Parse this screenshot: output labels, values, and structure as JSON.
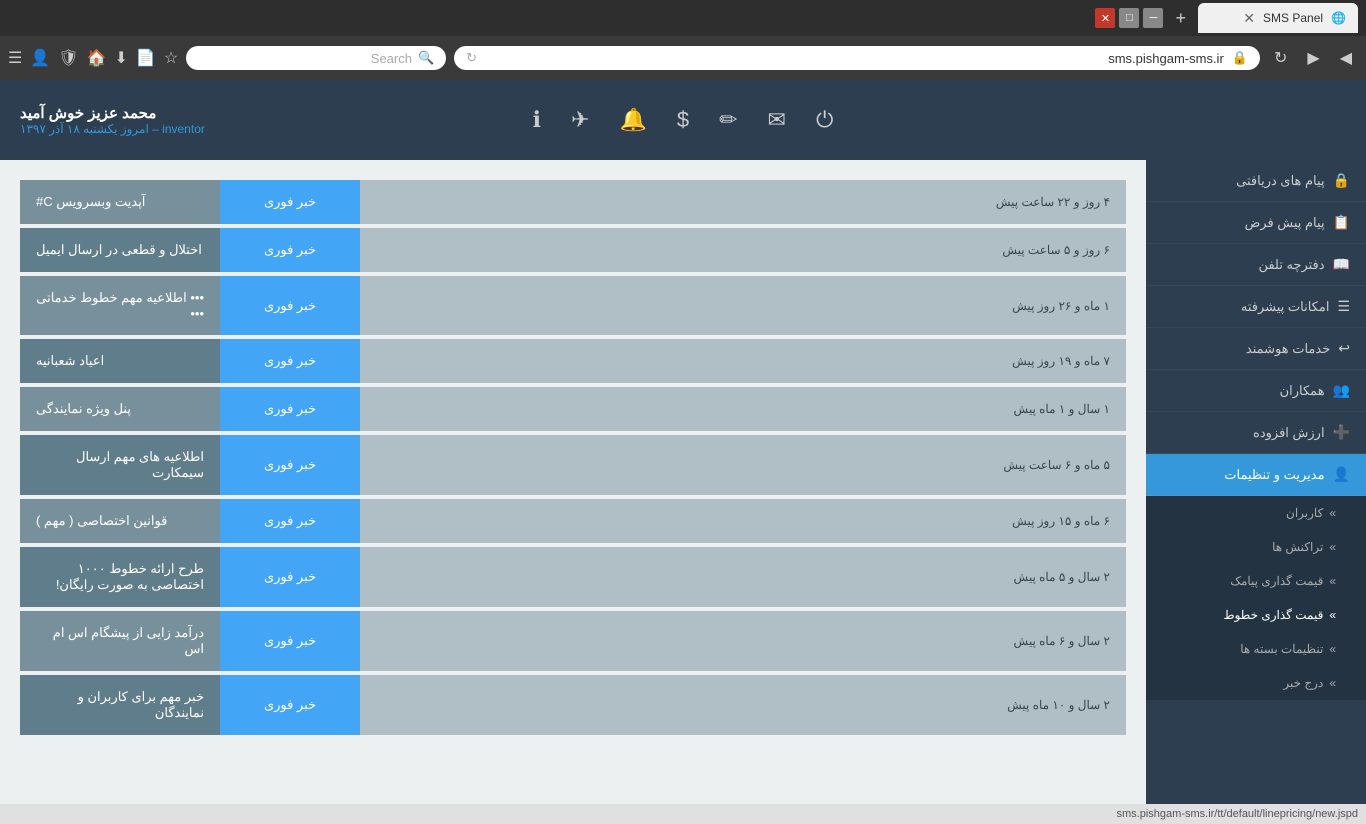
{
  "browser": {
    "tab_title": "SMS Panel",
    "url": "sms.pishgam-sms.ir",
    "search_placeholder": "Search"
  },
  "user": {
    "name": "محمد عزیز خوش آمید",
    "role": "inventor",
    "date_label": "امروز یکشنبه ۱۸ آذر ۱۳۹۷"
  },
  "sidebar": {
    "items": [
      {
        "id": "inbox",
        "label": "پیام های دریافتی",
        "icon": "🔒"
      },
      {
        "id": "template",
        "label": "پیام پیش فرض",
        "icon": "📋"
      },
      {
        "id": "phonebook",
        "label": "دفترچه تلفن",
        "icon": "📖"
      },
      {
        "id": "advanced",
        "label": "امکانات پیشرفته",
        "icon": "☰"
      },
      {
        "id": "smart",
        "label": "خدمات هوشمند",
        "icon": "↩"
      },
      {
        "id": "partners",
        "label": "همکاران",
        "icon": "👥"
      },
      {
        "id": "added_value",
        "label": "ارزش افزوده",
        "icon": "➕"
      },
      {
        "id": "management",
        "label": "مدیریت و تنظیمات",
        "icon": "👤",
        "active": true
      },
      {
        "id": "users",
        "label": "کاربران",
        "sub": true
      },
      {
        "id": "transactions",
        "label": "تراکنش ها",
        "sub": true
      },
      {
        "id": "sms_price",
        "label": "قیمت گذاری پیامک",
        "sub": true
      },
      {
        "id": "line_price",
        "label": "قیمت گذاری خطوط",
        "sub": true,
        "active_sub": true
      },
      {
        "id": "bundle_settings",
        "label": "تنظیمات بسته ها",
        "sub": true
      },
      {
        "id": "add_news",
        "label": "درج خبر",
        "sub": true
      }
    ]
  },
  "news": [
    {
      "time": "۴ روز و ۲۲ ساعت پیش",
      "type": "خبر فوری",
      "title": "آپدیت وبسرویس C#"
    },
    {
      "time": "۶ روز و ۵ ساعت پیش",
      "type": "خبر فوری",
      "title": "اختلال و قطعی در ارسال ایمیل"
    },
    {
      "time": "۱ ماه و ۲۶ روز پیش",
      "type": "خبر فوری",
      "title": "••• اطلاعیه مهم خطوط خدماتی •••"
    },
    {
      "time": "۷ ماه و ۱۹ روز پیش",
      "type": "خبر فوری",
      "title": "اعیاد شعبانیه"
    },
    {
      "time": "۱ سال و ۱ ماه پیش",
      "type": "خبر فوری",
      "title": "پنل ویژه نمایندگی"
    },
    {
      "time": "۵ ماه و ۶ ساعت پیش",
      "type": "خبر فوری",
      "title": "اطلاعیه های مهم ارسال سیمکارت"
    },
    {
      "time": "۶ ماه و ۱۵ روز پیش",
      "type": "خبر فوری",
      "title": "قوانین اختصاصی ( مهم )"
    },
    {
      "time": "۲ سال و ۵ ماه پیش",
      "type": "خبر فوری",
      "title": "طرح ارائه خطوط ۱۰۰۰ اختصاصی به صورت رایگان!"
    },
    {
      "time": "۲ سال و ۶ ماه پیش",
      "type": "خبر فوری",
      "title": "درآمد زایی از پیشگام اس ام اس"
    },
    {
      "time": "۲ سال و ۱۰ ماه پیش",
      "type": "خبر فوری",
      "title": "خبر مهم برای کاربران و نمایندگان"
    }
  ],
  "status_bar": {
    "url": "sms.pishgam-sms.ir/tt/default/linepricing/new.jspd"
  }
}
